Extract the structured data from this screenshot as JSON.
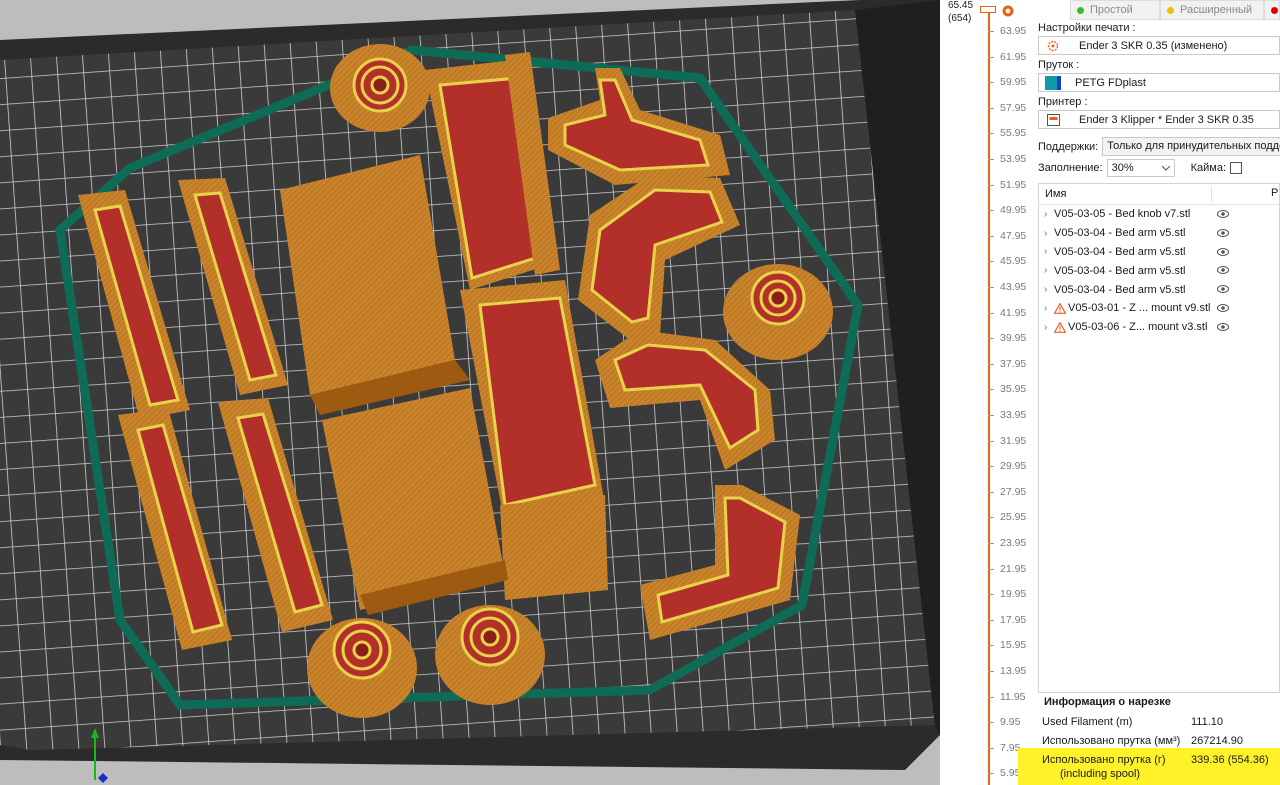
{
  "layer_slider": {
    "top_value": "65.45",
    "top_layer": "(654)",
    "ticks": [
      "63.95",
      "61.95",
      "59.95",
      "57.95",
      "55.95",
      "53.95",
      "51.95",
      "49.95",
      "47.95",
      "45.95",
      "43.95",
      "41.95",
      "39.95",
      "37.95",
      "35.95",
      "33.95",
      "31.95",
      "29.95",
      "27.95",
      "25.95",
      "23.95",
      "21.95",
      "19.95",
      "17.95",
      "15.95",
      "13.95",
      "11.95",
      "9.95",
      "7.95",
      "5.95"
    ]
  },
  "mode_tabs": [
    {
      "label": "Простой",
      "color": "#2fbf2f"
    },
    {
      "label": "Расширенный",
      "color": "#f0c000"
    },
    {
      "label": "",
      "color": "#e00000"
    }
  ],
  "print_settings": {
    "label": "Настройки печати :",
    "value": "Ender 3 SKR 0.35 (изменено)",
    "icon": "gear-icon"
  },
  "filament": {
    "label": "Пруток :",
    "value": "PETG FDplast",
    "icon": "filament-color-swatch"
  },
  "printer": {
    "label": "Принтер :",
    "value": "Ender 3 Klipper * Ender 3 SKR 0.35",
    "icon": "printer-icon"
  },
  "supports": {
    "label": "Поддержки:",
    "value": "Только для принудительных подде"
  },
  "infill": {
    "label": "Заполнение:",
    "value": "30%"
  },
  "brim": {
    "label": "Кайма:"
  },
  "object_list": {
    "header_name": "Имя",
    "header_r": "Р",
    "items": [
      {
        "name": "V05-03-05 - Bed knob v7.stl",
        "warning": false
      },
      {
        "name": "V05-03-04 - Bed arm v5.stl",
        "warning": false
      },
      {
        "name": "V05-03-04 - Bed arm v5.stl",
        "warning": false
      },
      {
        "name": "V05-03-04 - Bed arm v5.stl",
        "warning": false
      },
      {
        "name": "V05-03-04 - Bed arm v5.stl",
        "warning": false
      },
      {
        "name": "V05-03-01 - Z ... mount v9.stl",
        "warning": true
      },
      {
        "name": "V05-03-06 - Z... mount v3.stl",
        "warning": true
      }
    ]
  },
  "slice_info": {
    "title": "Информация о нарезке",
    "rows": [
      {
        "label": "Used Filament (m)",
        "value": "111.10"
      },
      {
        "label": "Использовано прутка (мм³)",
        "value": "267214.90"
      },
      {
        "label": "Использовано прутка (г)",
        "sublabel": "(including spool)",
        "value": "339.36 (554.36)"
      }
    ]
  },
  "colors": {
    "accent": "#e8631a",
    "highlight": "#fff229",
    "bed_grid": "#3a3a3a",
    "skirt": "#0e6b55",
    "part_orange": "#c8841f",
    "part_red": "#b1312a"
  }
}
